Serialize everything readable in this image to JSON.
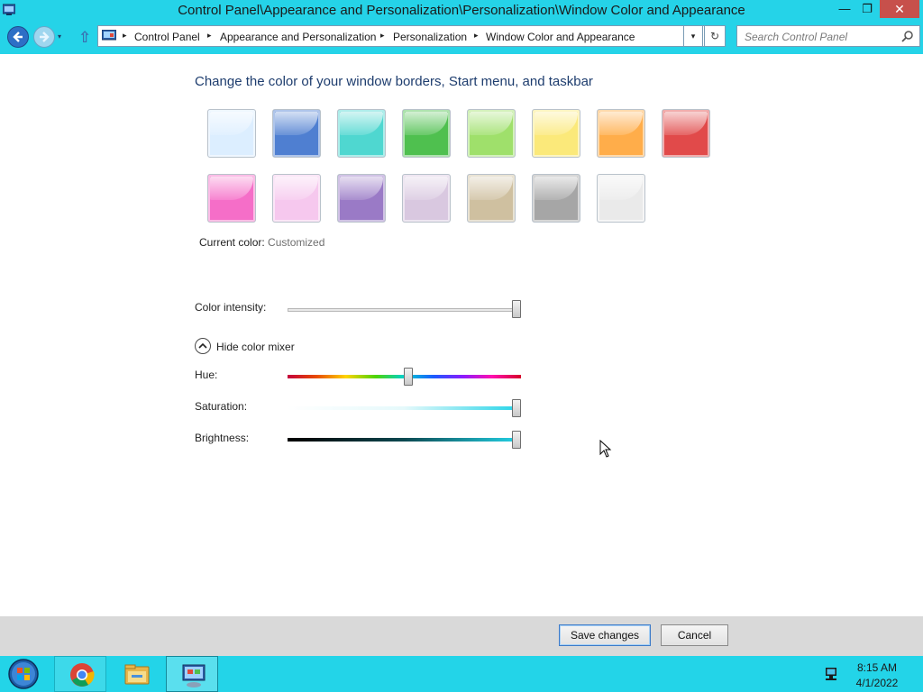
{
  "window": {
    "title": "Control Panel\\Appearance and Personalization\\Personalization\\Window Color and Appearance",
    "controls": {
      "minimize": "—",
      "maximize": "❐",
      "close": "✕"
    }
  },
  "nav": {
    "back_icon": "arrow-left-icon",
    "forward_icon": "arrow-right-icon",
    "recent_dropdown": "▾",
    "up_icon": "⇧",
    "breadcrumb": [
      "Control Panel",
      "Appearance and Personalization",
      "Personalization",
      "Window Color and Appearance"
    ],
    "crumb_separator": "▸",
    "dropdown_arrow": "▾",
    "refresh_glyph": "↻",
    "search_placeholder": "Search Control Panel"
  },
  "content": {
    "heading": "Change the color of your window borders, Start menu, and taskbar",
    "swatches": [
      {
        "name": "sky",
        "color": "#dceeff"
      },
      {
        "name": "twilight",
        "color": "#4f7fd1"
      },
      {
        "name": "sea-foam",
        "color": "#4fd7d0"
      },
      {
        "name": "leaf",
        "color": "#4fc04f"
      },
      {
        "name": "lime",
        "color": "#9fe06b"
      },
      {
        "name": "lemon",
        "color": "#fbe97a"
      },
      {
        "name": "pumpkin",
        "color": "#ffad4a"
      },
      {
        "name": "ruby",
        "color": "#e14a4a"
      },
      {
        "name": "fuchsia",
        "color": "#f56ec8"
      },
      {
        "name": "blush",
        "color": "#f6c8ee"
      },
      {
        "name": "violet",
        "color": "#9a7ac6"
      },
      {
        "name": "lavender",
        "color": "#d9c8e0"
      },
      {
        "name": "taupe",
        "color": "#cfc0a0"
      },
      {
        "name": "chocolate",
        "color": "#a6a6a6"
      },
      {
        "name": "slate",
        "color": "#eaeaea"
      }
    ],
    "current_color_label": "Current color:",
    "current_color_value": "Customized",
    "intensity_label": "Color intensity:",
    "mixer_toggle": "Hide color mixer",
    "hue_label": "Hue:",
    "saturation_label": "Saturation:",
    "brightness_label": "Brightness:",
    "levels": {
      "intensity": 1.0,
      "hue": 0.52,
      "saturation": 1.0,
      "brightness": 1.0
    },
    "accent_color": "#23d4e8"
  },
  "buttons": {
    "save": "Save changes",
    "cancel": "Cancel"
  },
  "taskbar": {
    "items": [
      "start-orb-icon",
      "chrome-icon",
      "file-explorer-icon",
      "control-panel-icon"
    ],
    "tray_icon": "network-icon",
    "time": "8:15 AM",
    "date": "4/1/2022"
  }
}
